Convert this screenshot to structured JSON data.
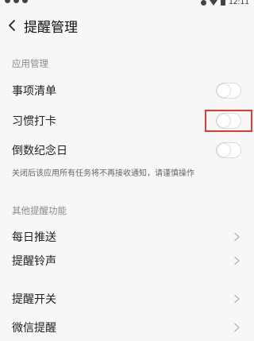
{
  "status_bar": {
    "time": "12:11"
  },
  "header": {
    "title": "提醒管理"
  },
  "sections": {
    "app_management": {
      "title": "应用管理",
      "items": [
        {
          "label": "事项清单",
          "toggle_on": false
        },
        {
          "label": "习惯打卡",
          "toggle_on": false
        },
        {
          "label": "倒数纪念日",
          "toggle_on": false
        }
      ],
      "hint": "关闭后该应用所有任务将不再接收通知，请谨慎操作"
    },
    "other_reminders": {
      "title": "其他提醒功能",
      "items": [
        {
          "label": "每日推送"
        },
        {
          "label": "提醒铃声"
        },
        {
          "label": "提醒开关"
        },
        {
          "label": "微信提醒"
        }
      ]
    }
  },
  "colors": {
    "background": "#f7f7f7",
    "highlight": "#e53935",
    "toggle_off_bg": "#ffffff"
  }
}
